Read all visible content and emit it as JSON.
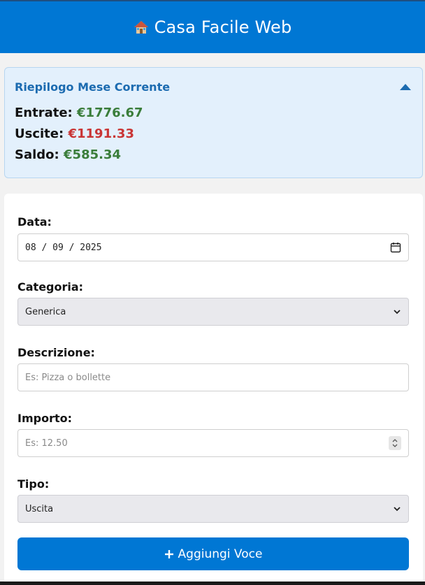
{
  "header": {
    "title": "Casa Facile Web",
    "icon": "house-icon",
    "bg_color": "#0077d4"
  },
  "summary": {
    "title": "Riepilogo Mese Corrente",
    "collapse_icon": "caret-up-icon",
    "income_label": "Entrate:",
    "income_value": "€1776.67",
    "expense_label": "Uscite:",
    "expense_value": "€1191.33",
    "balance_label": "Saldo:",
    "balance_value": "€585.34",
    "colors": {
      "positive": "#3a7d3a",
      "negative": "#c93535",
      "title": "#1c6bb0"
    }
  },
  "form": {
    "date": {
      "label": "Data:",
      "value": "08 / 09 / 2025",
      "icon": "calendar-icon"
    },
    "category": {
      "label": "Categoria:",
      "value": "Generica",
      "icon": "chevron-down-icon"
    },
    "description": {
      "label": "Descrizione:",
      "value": "",
      "placeholder": "Es: Pizza o bollette"
    },
    "amount": {
      "label": "Importo:",
      "value": "",
      "placeholder": "Es: 12.50",
      "icon": "spinner-icon"
    },
    "type": {
      "label": "Tipo:",
      "value": "Uscita",
      "icon": "chevron-down-icon"
    },
    "submit": {
      "label": "Aggiungi Voce",
      "icon": "plus-icon"
    }
  }
}
